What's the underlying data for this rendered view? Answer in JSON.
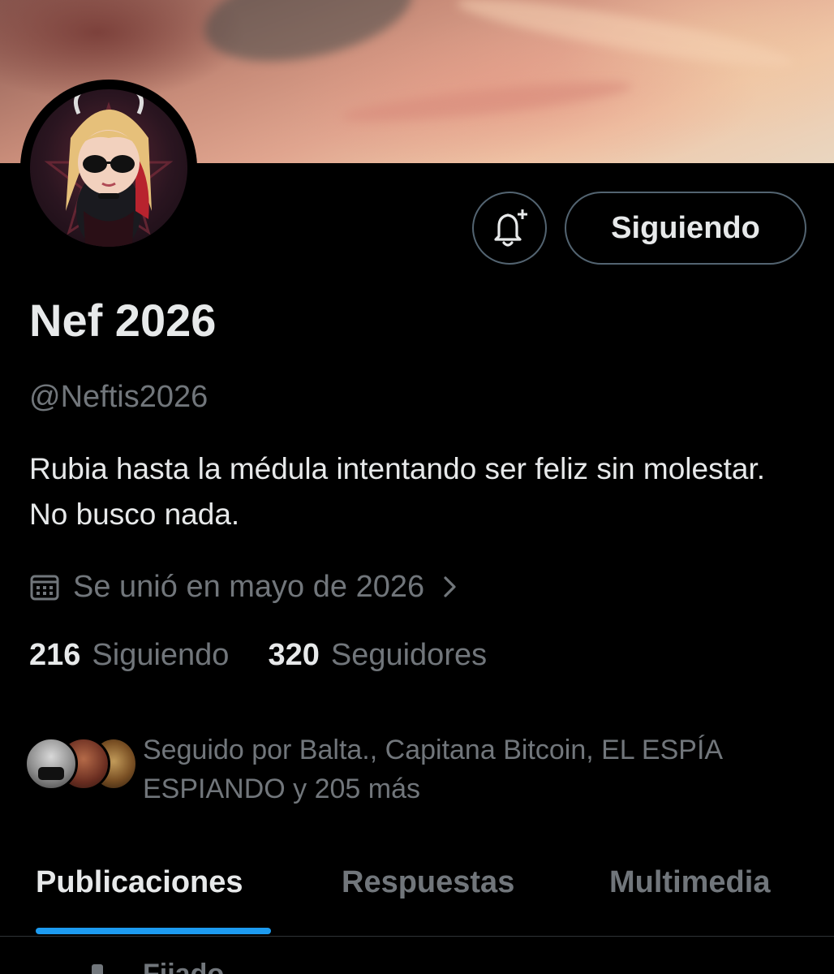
{
  "profile": {
    "display_name": "Nef 2026",
    "handle": "@Neftis2026",
    "bio": "Rubia hasta la médula intentando ser feliz sin molestar. No busco nada.",
    "joined": "Se unió en mayo de 2026"
  },
  "actions": {
    "follow_label": "Siguiendo",
    "bell_icon": "bell-plus-icon"
  },
  "stats": {
    "following_count": "216",
    "following_label": "Siguiendo",
    "followers_count": "320",
    "followers_label": "Seguidores"
  },
  "followed_by": {
    "text": "Seguido por Balta., Capitana Bitcoin, EL ESPÍA ESPIANDO y 205 más"
  },
  "tabs": [
    {
      "label": "Publicaciones",
      "active": true
    },
    {
      "label": "Respuestas",
      "active": false
    },
    {
      "label": "Multimedia",
      "active": false
    }
  ],
  "pinned": {
    "label": "Fijado"
  },
  "colors": {
    "accent": "#1d9bf0",
    "muted": "#71767b",
    "border": "#536471",
    "text": "#e7e9ea",
    "background": "#000000"
  }
}
